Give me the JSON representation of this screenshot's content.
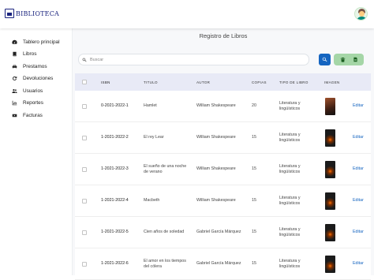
{
  "header": {
    "logo_text": "BIBLIOTECA",
    "avatar_label": "user-avatar"
  },
  "sidebar": {
    "items": [
      {
        "label": "Tablero principal",
        "icon": "dashboard-icon"
      },
      {
        "label": "Libros",
        "icon": "book-icon"
      },
      {
        "label": "Prestamos",
        "icon": "car-icon"
      },
      {
        "label": "Devoluciones",
        "icon": "refresh-icon"
      },
      {
        "label": "Usuarios",
        "icon": "users-icon"
      },
      {
        "label": "Reportes",
        "icon": "chart-icon"
      },
      {
        "label": "Facturas",
        "icon": "video-icon"
      }
    ]
  },
  "main": {
    "title": "Registro de Libros",
    "search": {
      "placeholder": "Buscar",
      "value": ""
    }
  },
  "table": {
    "columns": [
      "ISBN",
      "TITULO",
      "AUTOR",
      "COPIAS",
      "TIPO DE LIBRO",
      "IMAGEN"
    ],
    "action_label": "Editar",
    "rows": [
      {
        "isbn": "0-2021-2022-1",
        "titulo": "Hamlet",
        "autor": "William Shakespeare",
        "copias": "20",
        "tipo": "Literatura y lingüísticos",
        "image_tone": "#6d3b2a"
      },
      {
        "isbn": "1-2021-2022-2",
        "titulo": "El rey Lear",
        "autor": "William Shakespeare",
        "copias": "15",
        "tipo": "Literatura y lingüísticos",
        "image_tone": "#1b1b1b"
      },
      {
        "isbn": "1-2021-2022-3",
        "titulo": "El sueño de una noche de verano",
        "autor": "William Shakespeare",
        "copias": "15",
        "tipo": "Literatura y lingüísticos",
        "image_tone": "#1b1b1b"
      },
      {
        "isbn": "1-2021-2022-4",
        "titulo": "Macbeth",
        "autor": "William Shakespeare",
        "copias": "15",
        "tipo": "Literatura y lingüísticos",
        "image_tone": "#1b1b1b"
      },
      {
        "isbn": "1-2021-2022-5",
        "titulo": "Cien años de soledad",
        "autor": "Gabriel García Márquez",
        "copias": "15",
        "tipo": "Literatura y lingüísticos",
        "image_tone": "#1b1b1b"
      },
      {
        "isbn": "1-2021-2022-6",
        "titulo": "El amor en los tiempos del cólera",
        "autor": "Gabriel García Márquez",
        "copias": "15",
        "tipo": "Literatura y lingüísticos",
        "image_tone": "#1b1b1b"
      }
    ]
  }
}
